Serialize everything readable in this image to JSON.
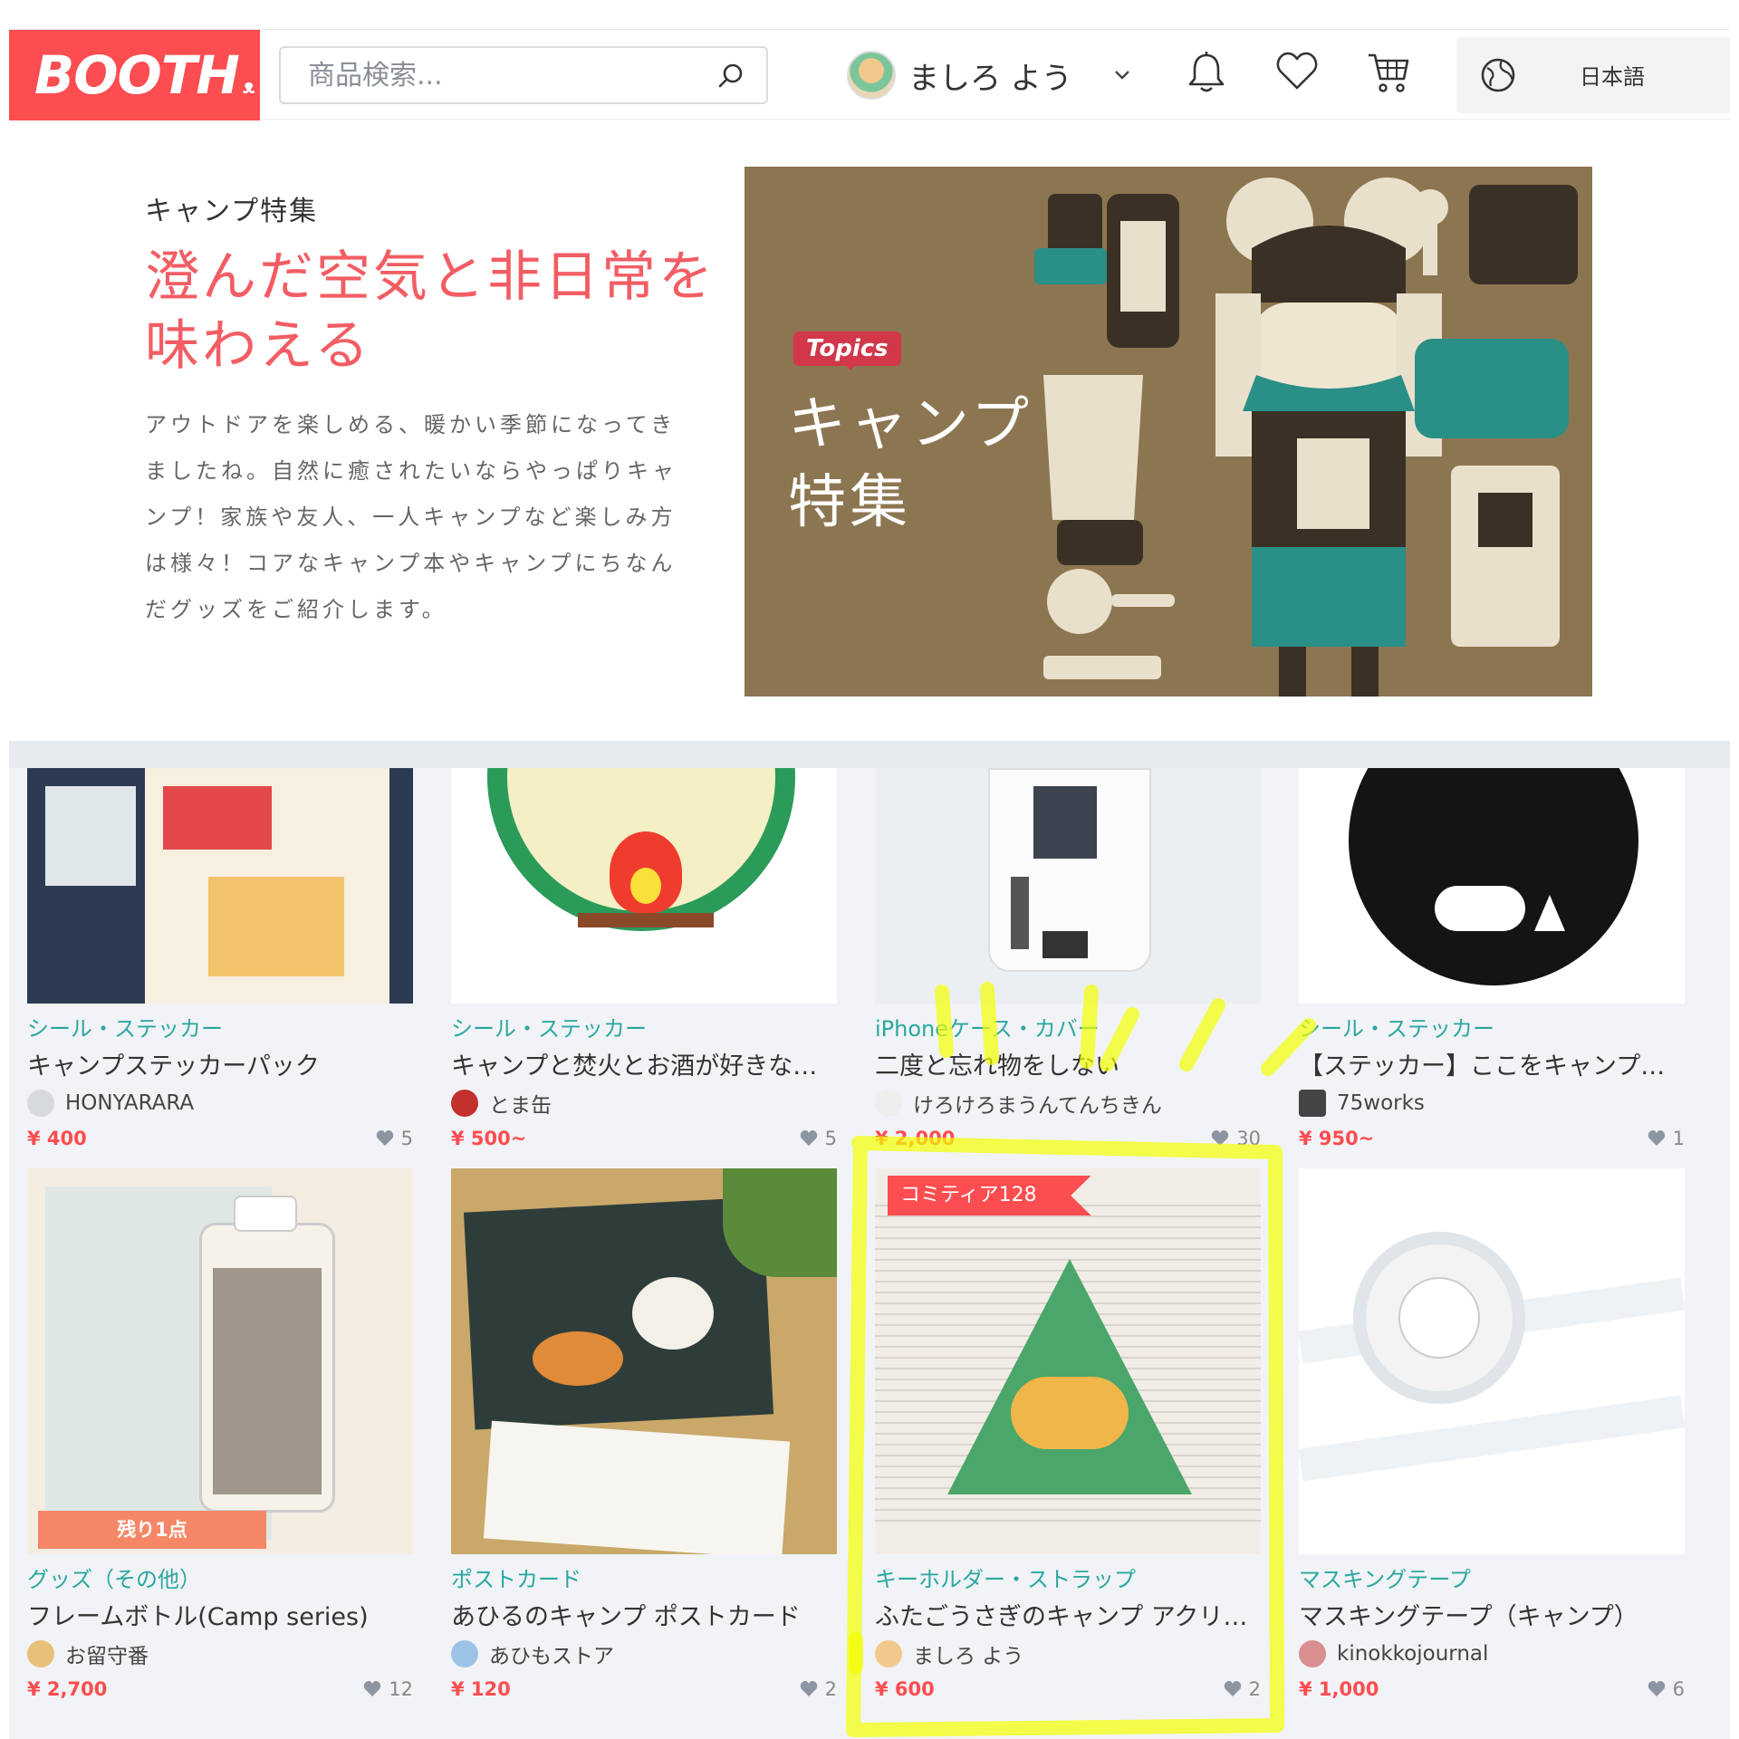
{
  "header": {
    "logo": "BOOTH",
    "search_placeholder": "商品検索...",
    "user_name": "ましろ よう",
    "language": "日本語"
  },
  "feature": {
    "eyebrow": "キャンプ特集",
    "title": "澄んだ空気と非日常を味わえる",
    "description": "アウトドアを楽しめる、暖かい季節になってきましたね。自然に癒されたいならやっぱりキャンプ！家族や友人、一人キャンプなど楽しみ方は様々！コアなキャンプ本やキャンプにちなんだグッズをご紹介します。",
    "banner_badge": "Topics",
    "banner_title": "キャンプ特集"
  },
  "products": [
    {
      "category": "シール・ステッカー",
      "title": "キャンプステッカーパック",
      "shop": "HONYARARA",
      "price": "¥ 400",
      "likes": "5"
    },
    {
      "category": "シール・ステッカー",
      "title": "キャンプと焚火とお酒が好きな人向...",
      "shop": "とま缶",
      "price": "¥ 500~",
      "likes": "5"
    },
    {
      "category": "iPhoneケース・カバー",
      "title": "二度と忘れ物をしない",
      "shop": "けろけろまうんてんちきん",
      "price": "¥ 2,000",
      "likes": "30"
    },
    {
      "category": "シール・ステッカー",
      "title": "【ステッカー】ここをキャンプ地と...",
      "shop": "75works",
      "price": "¥ 950~",
      "likes": "1"
    },
    {
      "category": "グッズ（その他）",
      "title": "フレームボトル(Camp series)",
      "shop": "お留守番",
      "price": "¥ 2,700",
      "likes": "12",
      "badge": "残り1点"
    },
    {
      "category": "ポストカード",
      "title": "あひるのキャンプ ポストカード",
      "shop": "あひもストア",
      "price": "¥ 120",
      "likes": "2"
    },
    {
      "category": "キーホルダー・ストラップ",
      "title": "ふたごうさぎのキャンプ アクリル...",
      "shop": "ましろ よう",
      "price": "¥ 600",
      "likes": "2",
      "badge": "コミティア128"
    },
    {
      "category": "マスキングテープ",
      "title": "マスキングテープ（キャンプ）",
      "shop": "kinokkojournal",
      "price": "¥ 1,000",
      "likes": "6"
    }
  ],
  "colors": {
    "brand": "#fc4d50",
    "category": "#2aa7a0",
    "highlight": "#f4ff00"
  }
}
